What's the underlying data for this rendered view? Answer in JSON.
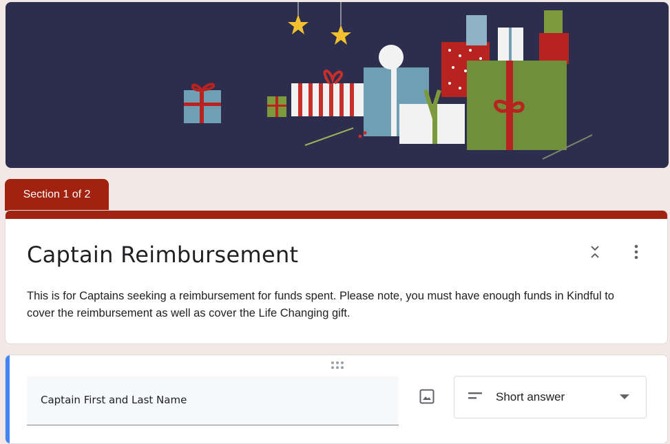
{
  "banner": {
    "theme": "holiday gifts"
  },
  "section_tab": {
    "label": "Section 1 of 2"
  },
  "form": {
    "title": "Captain Reimbursement",
    "description": "This is for Captains seeking a reimbursement for funds spent.  Please note, you must have enough funds in Kindful to cover the reimbursement as well as cover the Life Changing gift."
  },
  "header_actions": {
    "collapse_icon": "collapse-icon",
    "more_icon": "more-vert-icon"
  },
  "question": {
    "text": "Captain First and Last Name",
    "image_icon": "image-icon",
    "type_select": {
      "icon": "short-text-icon",
      "selected": "Short answer",
      "dropdown_icon": "arrow-drop-down-icon"
    }
  },
  "colors": {
    "accent": "#a0220f",
    "banner_bg": "#2d2e4d",
    "page_bg": "#f3e8e6",
    "active_bar": "#4285f4"
  }
}
